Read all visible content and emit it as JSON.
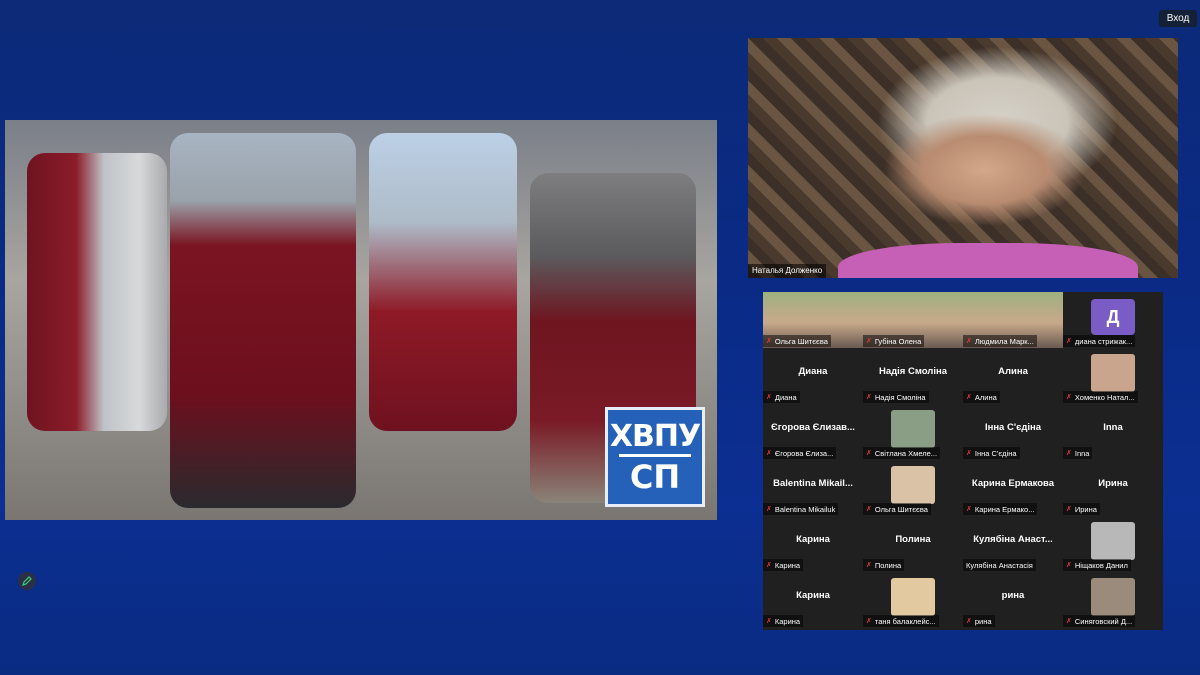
{
  "header": {
    "login_label": "Вход"
  },
  "share": {
    "logo_line1": "ХВПУ",
    "logo_line2": "СП"
  },
  "speaker": {
    "name": "Наталья Долженко"
  },
  "colors": {
    "background": "#0b2f92",
    "tile_bg": "#202020",
    "muted_mic": "#e03a3a",
    "avatar_letter_bg": "#7a5cc7"
  },
  "participants": [
    {
      "title": "",
      "label": "Ольга Шитєєва",
      "video": true,
      "muted": true
    },
    {
      "title": "",
      "label": "Губіна Олена",
      "video": true,
      "muted": true
    },
    {
      "title": "",
      "label": "Людмила Марк...",
      "video": true,
      "muted": true
    },
    {
      "title": "",
      "label": "диана стрижак...",
      "video": false,
      "muted": true,
      "letter": "Д"
    },
    {
      "title": "Диана",
      "label": "Диана",
      "video": false,
      "muted": true
    },
    {
      "title": "Надія Смоліна",
      "label": "Надія Смоліна",
      "video": false,
      "muted": true
    },
    {
      "title": "Алина",
      "label": "Алина",
      "video": false,
      "muted": true
    },
    {
      "title": "",
      "label": "Хоменко Натал...",
      "video": false,
      "muted": true,
      "photo": true
    },
    {
      "title": "Єгорова Єлизав...",
      "label": "Єгорова Єлиза...",
      "video": false,
      "muted": true
    },
    {
      "title": "",
      "label": "Світлана Хмеле...",
      "video": false,
      "muted": true,
      "photo": true
    },
    {
      "title": "Інна С'єдіна",
      "label": "Інна С'єдіна",
      "video": false,
      "muted": true
    },
    {
      "title": "Inna",
      "label": "Inna",
      "video": false,
      "muted": true
    },
    {
      "title": "Balentina Mikail...",
      "label": "Balentina Mikailuk",
      "video": false,
      "muted": true
    },
    {
      "title": "",
      "label": "Ольга Шитєєва",
      "video": false,
      "muted": true,
      "photo": true
    },
    {
      "title": "Карина Ермакова",
      "label": "Карина Ермако...",
      "video": false,
      "muted": true
    },
    {
      "title": "Ирина",
      "label": "Ирина",
      "video": false,
      "muted": true
    },
    {
      "title": "Карина",
      "label": "Карина",
      "video": false,
      "muted": true
    },
    {
      "title": "Полина",
      "label": "Полина",
      "video": false,
      "muted": true
    },
    {
      "title": "Кулябіна Анаст...",
      "label": "Кулябіна Анастасія",
      "video": false,
      "muted": false
    },
    {
      "title": "",
      "label": "Ніщаков Данил",
      "video": false,
      "muted": true,
      "photo": true
    },
    {
      "title": "Карина",
      "label": "Карина",
      "video": false,
      "muted": true
    },
    {
      "title": "",
      "label": "таня балаклейс...",
      "video": false,
      "muted": true,
      "photo": true
    },
    {
      "title": "рина",
      "label": "рина",
      "video": false,
      "muted": true
    },
    {
      "title": "",
      "label": "Синяговский Д...",
      "video": false,
      "muted": true,
      "photo": true
    }
  ]
}
